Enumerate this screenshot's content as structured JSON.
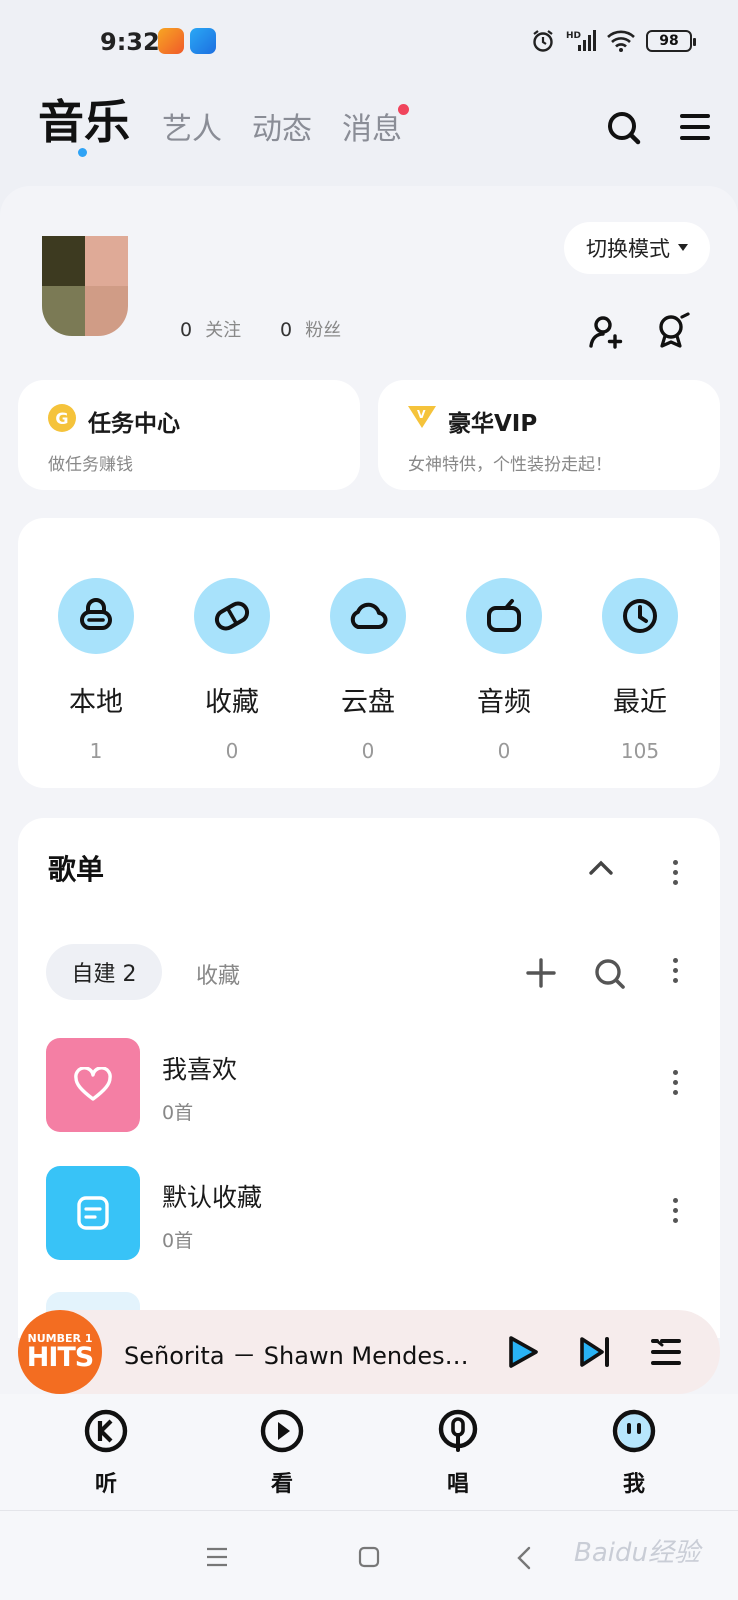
{
  "status_bar": {
    "time": "9:32",
    "battery": "98",
    "network": "HD"
  },
  "top_nav": {
    "tabs": [
      {
        "label": "音乐",
        "active": true
      },
      {
        "label": "艺人"
      },
      {
        "label": "动态"
      },
      {
        "label": "消息",
        "has_dot": true
      }
    ],
    "icons": [
      "search-icon",
      "menu-icon"
    ]
  },
  "profile": {
    "follow_count": "0",
    "follow_label": "关注",
    "fans_count": "0",
    "fans_label": "粉丝",
    "mode_button": "切换模式"
  },
  "promo_cards": [
    {
      "title": "任务中心",
      "subtitle": "做任务赚钱",
      "icon": "gold-coin-icon"
    },
    {
      "title": "豪华VIP",
      "subtitle": "女神特供，个性装扮走起！",
      "icon": "vip-diamond-icon"
    }
  ],
  "quick_access": [
    {
      "label": "本地",
      "count": "1",
      "icon": "local-icon"
    },
    {
      "label": "收藏",
      "count": "0",
      "icon": "favorite-icon"
    },
    {
      "label": "云盘",
      "count": "0",
      "icon": "cloud-icon"
    },
    {
      "label": "音频",
      "count": "0",
      "icon": "radio-icon"
    },
    {
      "label": "最近",
      "count": "105",
      "icon": "clock-icon"
    }
  ],
  "playlists_section": {
    "title": "歌单",
    "tab_created": "自建 2",
    "tab_collected": "收藏",
    "items": [
      {
        "name": "我喜欢",
        "count": "0首",
        "color": "#f47fa4"
      },
      {
        "name": "默认收藏",
        "count": "0首",
        "color": "#38c3f7"
      }
    ]
  },
  "mini_player": {
    "art_line1": "NUMBER 1",
    "art_line2": "HITS",
    "track": "Señorita － Shawn Mendes／Camila Cabello"
  },
  "bottom_tabs": [
    {
      "label": "听",
      "icon": "listen-k-icon"
    },
    {
      "label": "看",
      "icon": "watch-play-icon"
    },
    {
      "label": "唱",
      "icon": "sing-mic-icon"
    },
    {
      "label": "我",
      "icon": "me-face-icon",
      "active": true
    }
  ],
  "watermark": "Baidu经验",
  "colors": {
    "accent_blue": "#2fa3f5",
    "icon_circle": "#a8e2fb",
    "notification_red": "#f0445c",
    "player_art": "#f36d21"
  }
}
